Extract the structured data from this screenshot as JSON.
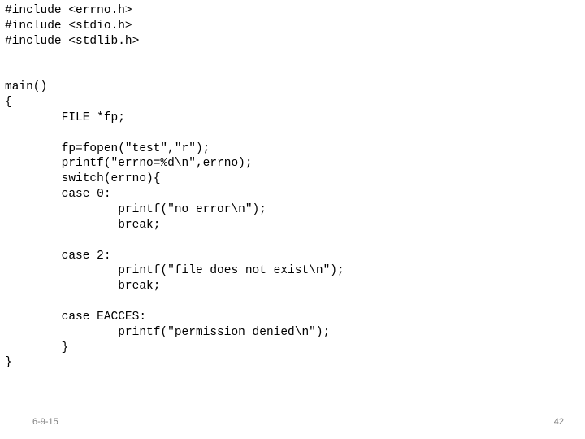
{
  "code": {
    "l1": "#include <errno.h>",
    "l2": "#include <stdio.h>",
    "l3": "#include <stdlib.h>",
    "l4": "",
    "l5": "",
    "l6": "main()",
    "l7": "{",
    "l8": "        FILE *fp;",
    "l9": "",
    "l10": "        fp=fopen(\"test\",\"r\");",
    "l11": "        printf(\"errno=%d\\n\",errno);",
    "l12": "        switch(errno){",
    "l13": "        case 0:",
    "l14": "                printf(\"no error\\n\");",
    "l15": "                break;",
    "l16": "",
    "l17": "        case 2:",
    "l18": "                printf(\"file does not exist\\n\");",
    "l19": "                break;",
    "l20": "",
    "l21": "        case EACCES:",
    "l22": "                printf(\"permission denied\\n\");",
    "l23": "        }",
    "l24": "}"
  },
  "footer": {
    "date": "6-9-15",
    "page": "42"
  }
}
